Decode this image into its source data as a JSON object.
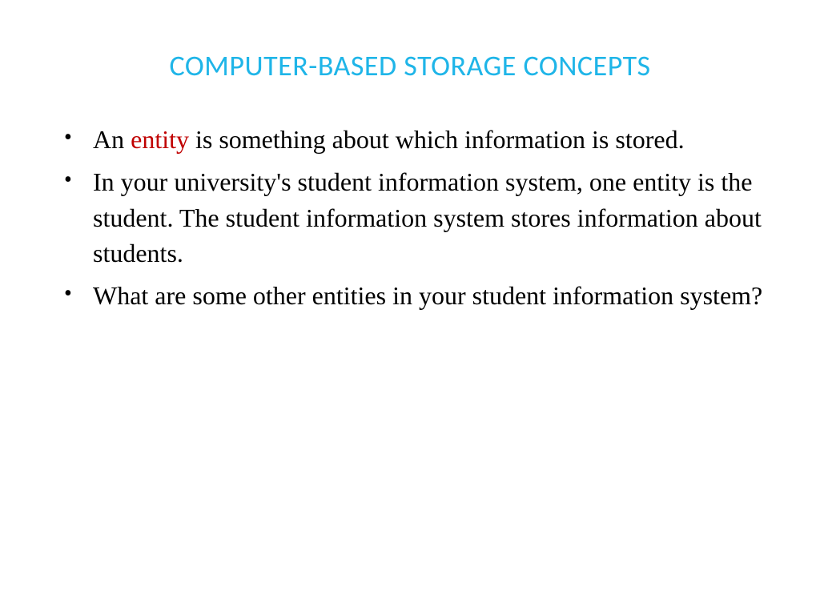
{
  "title": "COMPUTER-BASED STORAGE CONCEPTS",
  "bullets": {
    "b1_pre": "An ",
    "b1_highlight": "entity",
    "b1_post": " is something about which information is stored.",
    "b2": "In your university's student information system, one entity is the student.  The student information system stores information about students.",
    "b3": "What are some other entities in your student information system?"
  }
}
